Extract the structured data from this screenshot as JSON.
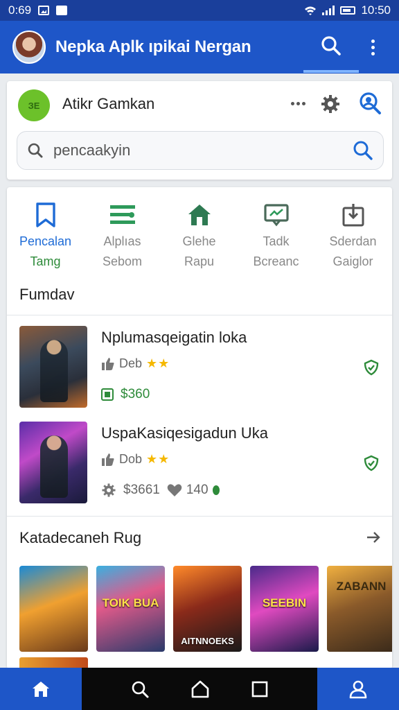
{
  "status_bar": {
    "time_left": "0:69",
    "time_right": "10:50"
  },
  "app_bar": {
    "title": "Nepka Aplk ıpikai Nergan"
  },
  "header": {
    "logo_text": "ЗЕ",
    "app_name": "Atikr Gamkan",
    "search_placeholder": "pencaakyin"
  },
  "categories": [
    {
      "line1": "Pencalan",
      "line2": "Tamg",
      "icon": "bookmark-icon",
      "active": true
    },
    {
      "line1": "Alplıas",
      "line2": "Sebom",
      "icon": "list-icon",
      "active": false
    },
    {
      "line1": "Glehe",
      "line2": "Rapu",
      "icon": "house-icon",
      "active": false
    },
    {
      "line1": "Tadk",
      "line2": "Bcreanc",
      "icon": "monitor-icon",
      "active": false
    },
    {
      "line1": "Sderdan",
      "line2": "Gaiglor",
      "icon": "download-icon",
      "active": false
    }
  ],
  "section_featured": "Fumdav",
  "apps": [
    {
      "title": "Nplumasqeigatin loka",
      "rating_label": "Deb",
      "stars": "★★",
      "price": "$360",
      "status_icon": "check-shield-icon"
    },
    {
      "title": "UspaKasiqesigadun Uka",
      "rating_label": "Dob",
      "stars": "★★",
      "price": "$3661",
      "likes": "140",
      "status_icon": "check-shield-icon"
    }
  ],
  "section_games": "Katadecaneh Rug",
  "games": [
    {
      "label": ""
    },
    {
      "label": "TOIK BUA"
    },
    {
      "label": "AITNNOEKS"
    },
    {
      "label": "SEEBIN"
    },
    {
      "label": "ZABANN"
    }
  ],
  "colors": {
    "primary": "#1e56c8",
    "status_bar": "#1a3f9b",
    "accent_green": "#2e8b3a",
    "star": "#f5b800"
  }
}
